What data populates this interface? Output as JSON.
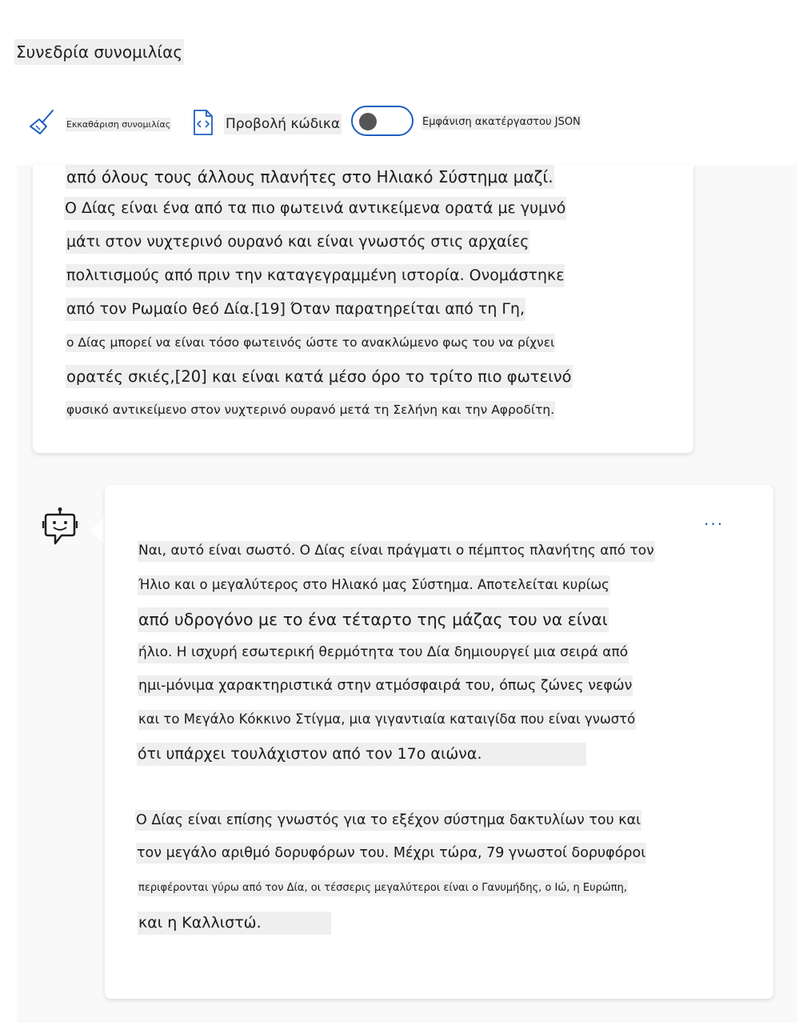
{
  "session": {
    "title": "Συνεδρία συνομιλίας"
  },
  "toolbar": {
    "clear_label": "Εκκαθάριση συνομιλίας",
    "code_label": "Προβολή κώδικα",
    "json_label": "Εμφάνιση ακατέργαστου JSON",
    "json_toggle_on": false
  },
  "user_message": {
    "lines": [
      "από όλους τους άλλους πλανήτες στο Ηλιακό Σύστημα μαζί.",
      "Ο Δίας είναι ένα από τα πιο φωτεινά αντικείμενα ορατά με γυμνό",
      "μάτι στον νυχτερινό ουρανό και είναι γνωστός στις αρχαίες",
      "πολιτισμούς από πριν την καταγεγραμμένη ιστορία. Ονομάστηκε",
      "από τον Ρωμαίο θεό Δία.[19] Όταν παρατηρείται από τη Γη,",
      "ο Δίας μπορεί να είναι τόσο φωτεινός ώστε το ανακλώμενο φως του να ρίχνει",
      "ορατές σκιές,[20] και είναι κατά μέσο όρο το τρίτο πιο φωτεινό",
      "φυσικό αντικείμενο στον νυχτερινό ουρανό μετά τη Σελήνη και την Αφροδίτη."
    ]
  },
  "bot_message": {
    "more_label": "...",
    "lines": [
      "Ναι, αυτό είναι σωστό. Ο Δίας είναι πράγματι ο πέμπτος πλανήτης από τον",
      "Ήλιο και ο μεγαλύτερος στο Ηλιακό μας Σύστημα. Αποτελείται κυρίως",
      "από υδρογόνο με το ένα τέταρτο της μάζας του να είναι",
      "ήλιο. Η ισχυρή εσωτερική θερμότητα του Δία δημιουργεί μια σειρά από",
      "ημι-μόνιμα χαρακτηριστικά στην ατμόσφαιρά του, όπως ζώνες νεφών",
      "και το Μεγάλο Κόκκινο Στίγμα, μια γιγαντιαία καταιγίδα που είναι γνωστό",
      "ότι υπάρχει τουλάχιστον από τον 17ο αιώνα.",
      "Ο Δίας είναι επίσης γνωστός για το εξέχον σύστημα δακτυλίων του και",
      "τον μεγάλο αριθμό δορυφόρων του. Μέχρι τώρα, 79 γνωστοί δορυφόροι",
      "περιφέρονται γύρω από τον Δία, οι τέσσερις μεγαλύτεροι είναι ο Γανυμήδης, ο Ιώ, η Ευρώπη,",
      "και η Καλλιστώ."
    ]
  }
}
